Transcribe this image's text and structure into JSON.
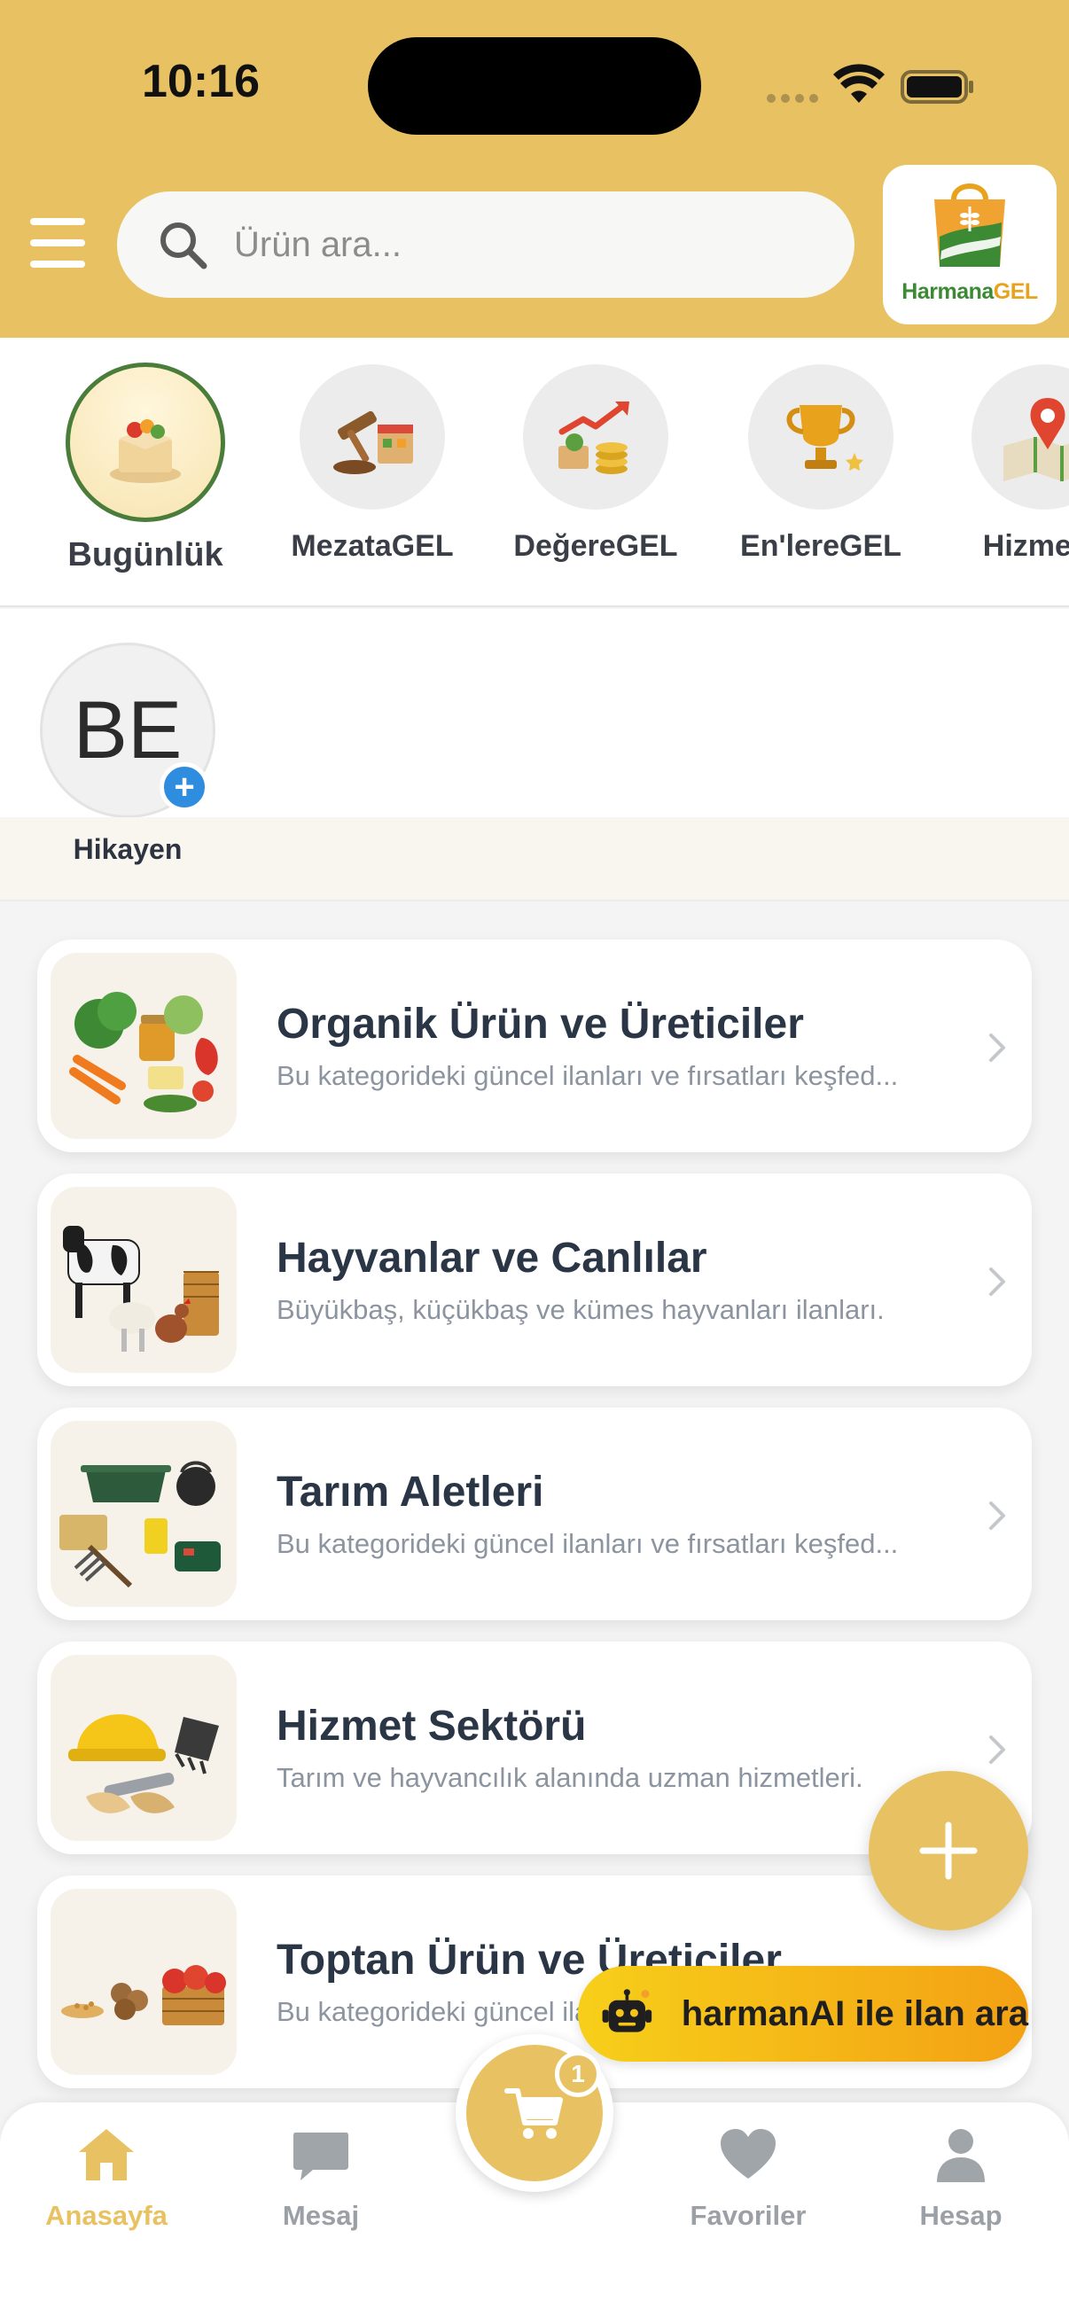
{
  "status_bar": {
    "time": "10:16"
  },
  "header": {
    "search_placeholder": "Ürün ara...",
    "logo_text_part1": "Harmana",
    "logo_text_part2": "GEL"
  },
  "shortcuts": [
    {
      "label": "Bugünlük",
      "active": true
    },
    {
      "label": "MezataGEL"
    },
    {
      "label": "DeğereGEL"
    },
    {
      "label": "En'lereGEL"
    },
    {
      "label": "Hizmet'e"
    }
  ],
  "story": {
    "initials": "BE",
    "plus": "+",
    "label": "Hikayen"
  },
  "categories": [
    {
      "title": "Organik Ürün ve Üreticiler",
      "subtitle": "Bu kategorideki güncel ilanları ve fırsatları keşfed..."
    },
    {
      "title": "Hayvanlar ve Canlılar",
      "subtitle": "Büyükbaş, küçükbaş ve kümes hayvanları ilanları."
    },
    {
      "title": "Tarım Aletleri",
      "subtitle": "Bu kategorideki güncel ilanları ve fırsatları keşfed..."
    },
    {
      "title": "Hizmet Sektörü",
      "subtitle": "Tarım ve hayvancılık alanında uzman hizmetleri."
    },
    {
      "title": "Toptan Ürün ve Üreticiler",
      "subtitle": "Bu kategorideki güncel ilanları ve fırsatları keşfed..."
    }
  ],
  "ai_button": {
    "label": "harmanAI ile ilan ara"
  },
  "cart": {
    "badge": "1"
  },
  "bottom_nav": [
    {
      "label": "Anasayfa",
      "active": true
    },
    {
      "label": "Mesaj"
    },
    {
      "label": "Favoriler"
    },
    {
      "label": "Hesap"
    }
  ],
  "colors": {
    "brand_yellow": "#e8c262",
    "brand_green": "#3d8a34",
    "accent_blue": "#2f8de0"
  }
}
